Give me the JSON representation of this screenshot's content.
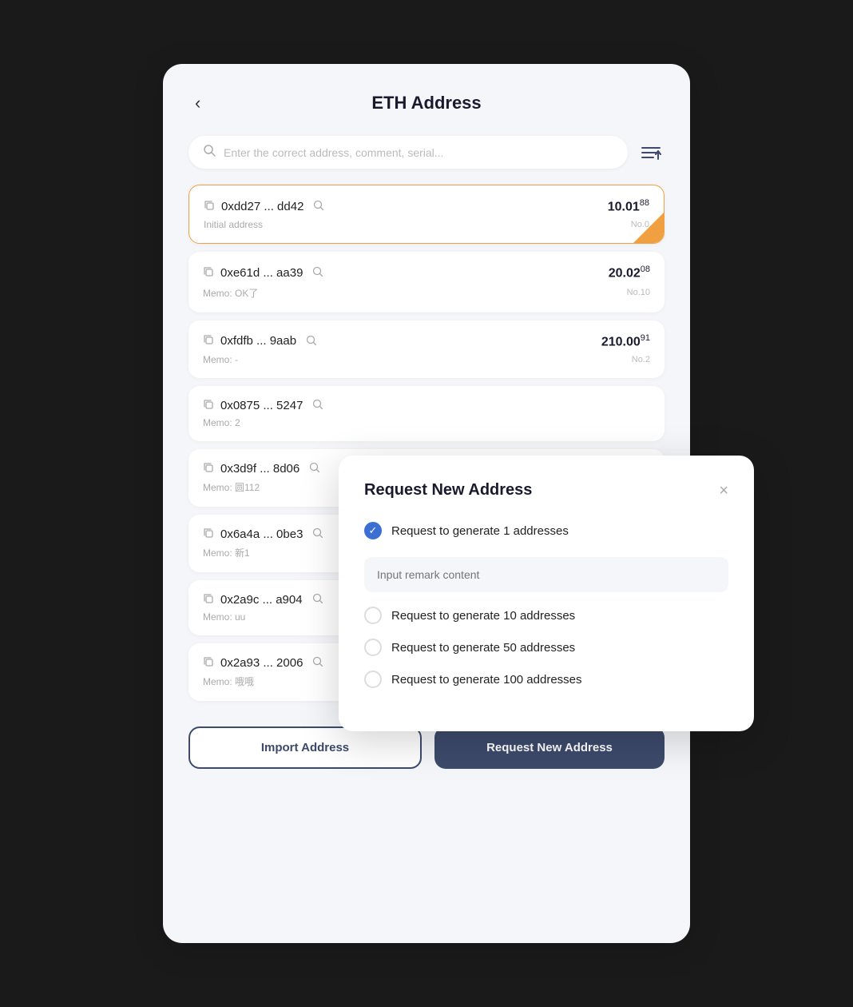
{
  "page": {
    "title": "ETH Address",
    "back_label": "‹"
  },
  "search": {
    "placeholder": "Enter the correct address, comment, serial..."
  },
  "addresses": [
    {
      "address": "0xdd27 ... dd42",
      "memo": "Initial address",
      "amount_main": "10.01",
      "amount_sub": "88",
      "no": "No.0",
      "active": true
    },
    {
      "address": "0xe61d ... aa39",
      "memo": "Memo: OK了",
      "amount_main": "20.02",
      "amount_sub": "08",
      "no": "No.10",
      "active": false
    },
    {
      "address": "0xfdfb ... 9aab",
      "memo": "Memo: -",
      "amount_main": "210.00",
      "amount_sub": "91",
      "no": "No.2",
      "active": false
    },
    {
      "address": "0x0875 ... 5247",
      "memo": "Memo: 2",
      "amount_main": "",
      "amount_sub": "",
      "no": "",
      "active": false
    },
    {
      "address": "0x3d9f ... 8d06",
      "memo": "Memo: 圆112",
      "amount_main": "",
      "amount_sub": "",
      "no": "",
      "active": false
    },
    {
      "address": "0x6a4a ... 0be3",
      "memo": "Memo: 新1",
      "amount_main": "",
      "amount_sub": "",
      "no": "",
      "active": false
    },
    {
      "address": "0x2a9c ... a904",
      "memo": "Memo: uu",
      "amount_main": "",
      "amount_sub": "",
      "no": "",
      "active": false
    },
    {
      "address": "0x2a93 ... 2006",
      "memo": "Memo: 哦哦",
      "amount_main": "",
      "amount_sub": "",
      "no": "",
      "active": false
    }
  ],
  "buttons": {
    "import": "Import Address",
    "request": "Request New Address"
  },
  "modal": {
    "title": "Request New Address",
    "close_label": "×",
    "remark_placeholder": "Input remark content",
    "options": [
      {
        "label": "Request to generate 1 addresses",
        "checked": true
      },
      {
        "label": "Request to generate 10 addresses",
        "checked": false
      },
      {
        "label": "Request to generate 50 addresses",
        "checked": false
      },
      {
        "label": "Request to generate 100 addresses",
        "checked": false
      }
    ]
  }
}
